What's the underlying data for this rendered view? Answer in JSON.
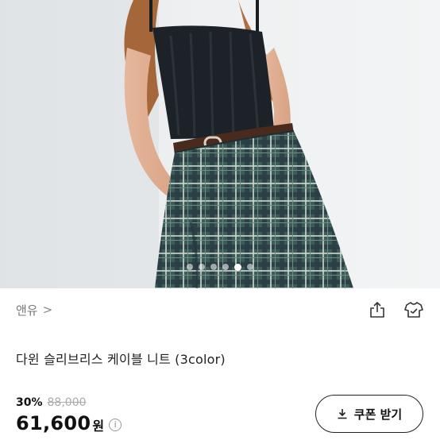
{
  "gallery": {
    "image_alt": "",
    "slide_count": 6,
    "active_slide_index": 4
  },
  "brand": {
    "name": "앤유",
    "chevron": ">"
  },
  "actions": {
    "share_icon": "share-icon",
    "closet_icon": "closet-icon"
  },
  "product": {
    "title": "다윈 슬리브리스 케이블 니트 (3color)"
  },
  "price": {
    "discount_rate": "30%",
    "original_price": "88,000",
    "sale_price": "61,600",
    "currency_unit": "원",
    "info_icon_glyph": "i"
  },
  "coupon": {
    "label": "쿠폰 받기",
    "icon": "download-icon"
  },
  "colors": {
    "text_primary": "#111111",
    "text_muted": "#777777",
    "strike": "#aaaaaa",
    "border": "#222222"
  }
}
